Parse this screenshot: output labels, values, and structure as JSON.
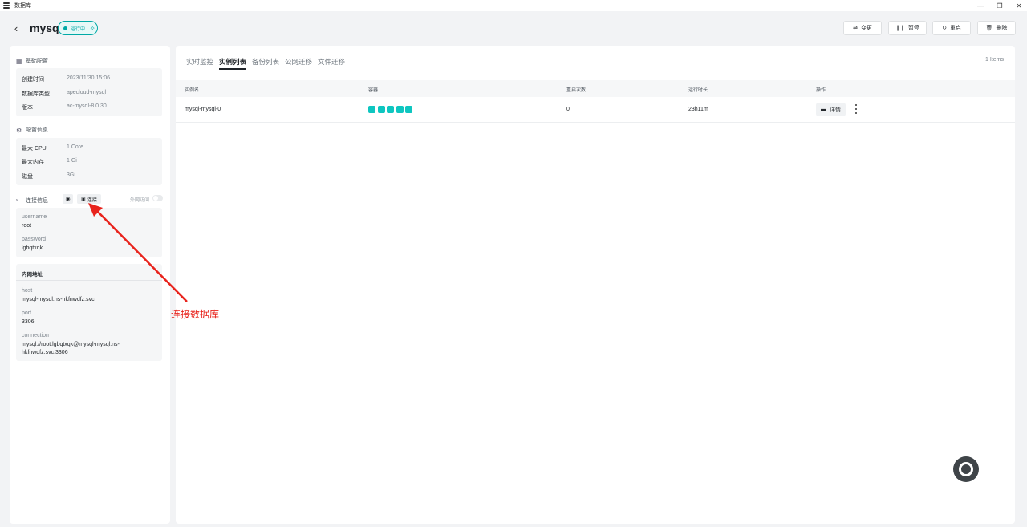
{
  "window": {
    "title": "数据库",
    "controls": [
      "—",
      "❐",
      "✕"
    ]
  },
  "header": {
    "app_name": "mysql",
    "status": "运行中",
    "buttons": {
      "change": "变更",
      "pause": "暂停",
      "restart": "重启",
      "delete": "删除"
    }
  },
  "basic": {
    "title": "基础配置",
    "rows": [
      {
        "k": "创建时间",
        "v": "2023/11/30 15:06"
      },
      {
        "k": "数据库类型",
        "v": "apecloud-mysql"
      },
      {
        "k": "版本",
        "v": "ac-mysql-8.0.30"
      }
    ]
  },
  "config": {
    "title": "配置信息",
    "rows": [
      {
        "k": "最大 CPU",
        "v": "1 Core"
      },
      {
        "k": "最大内存",
        "v": "1 Gi"
      },
      {
        "k": "磁盘",
        "v": "3Gi"
      }
    ]
  },
  "connection": {
    "title": "连接信息",
    "connect_label": "连接",
    "external_label": "外网访问",
    "username_label": "username",
    "username": "root",
    "password_label": "password",
    "password": "lgbqtxqk",
    "internal_title": "内网地址",
    "host_label": "host",
    "host": "mysql-mysql.ns-hkfnwdfz.svc",
    "port_label": "port",
    "port": "3306",
    "conn_label": "connection",
    "conn_line1": "mysql://root:lgbqtxqk@mysql-mysql.ns-",
    "conn_line2": "hkfnwdfz.svc:3306"
  },
  "tabs": [
    "实时监控",
    "实例列表",
    "备份列表",
    "公网迁移",
    "文件迁移"
  ],
  "active_tab": "实例列表",
  "items_count": "1 Items",
  "table": {
    "headers": [
      "实例名",
      "容器",
      "重启次数",
      "运行时长",
      "操作"
    ],
    "rows": [
      {
        "name": "mysql-mysql-0",
        "containers": 5,
        "restarts": "0",
        "uptime": "23h11m",
        "detail": "详情"
      }
    ]
  },
  "annotation": "连接数据库",
  "colors": {
    "accent": "#00a9a6",
    "pod": "#0ec6c0",
    "annotation": "#e8231c"
  }
}
